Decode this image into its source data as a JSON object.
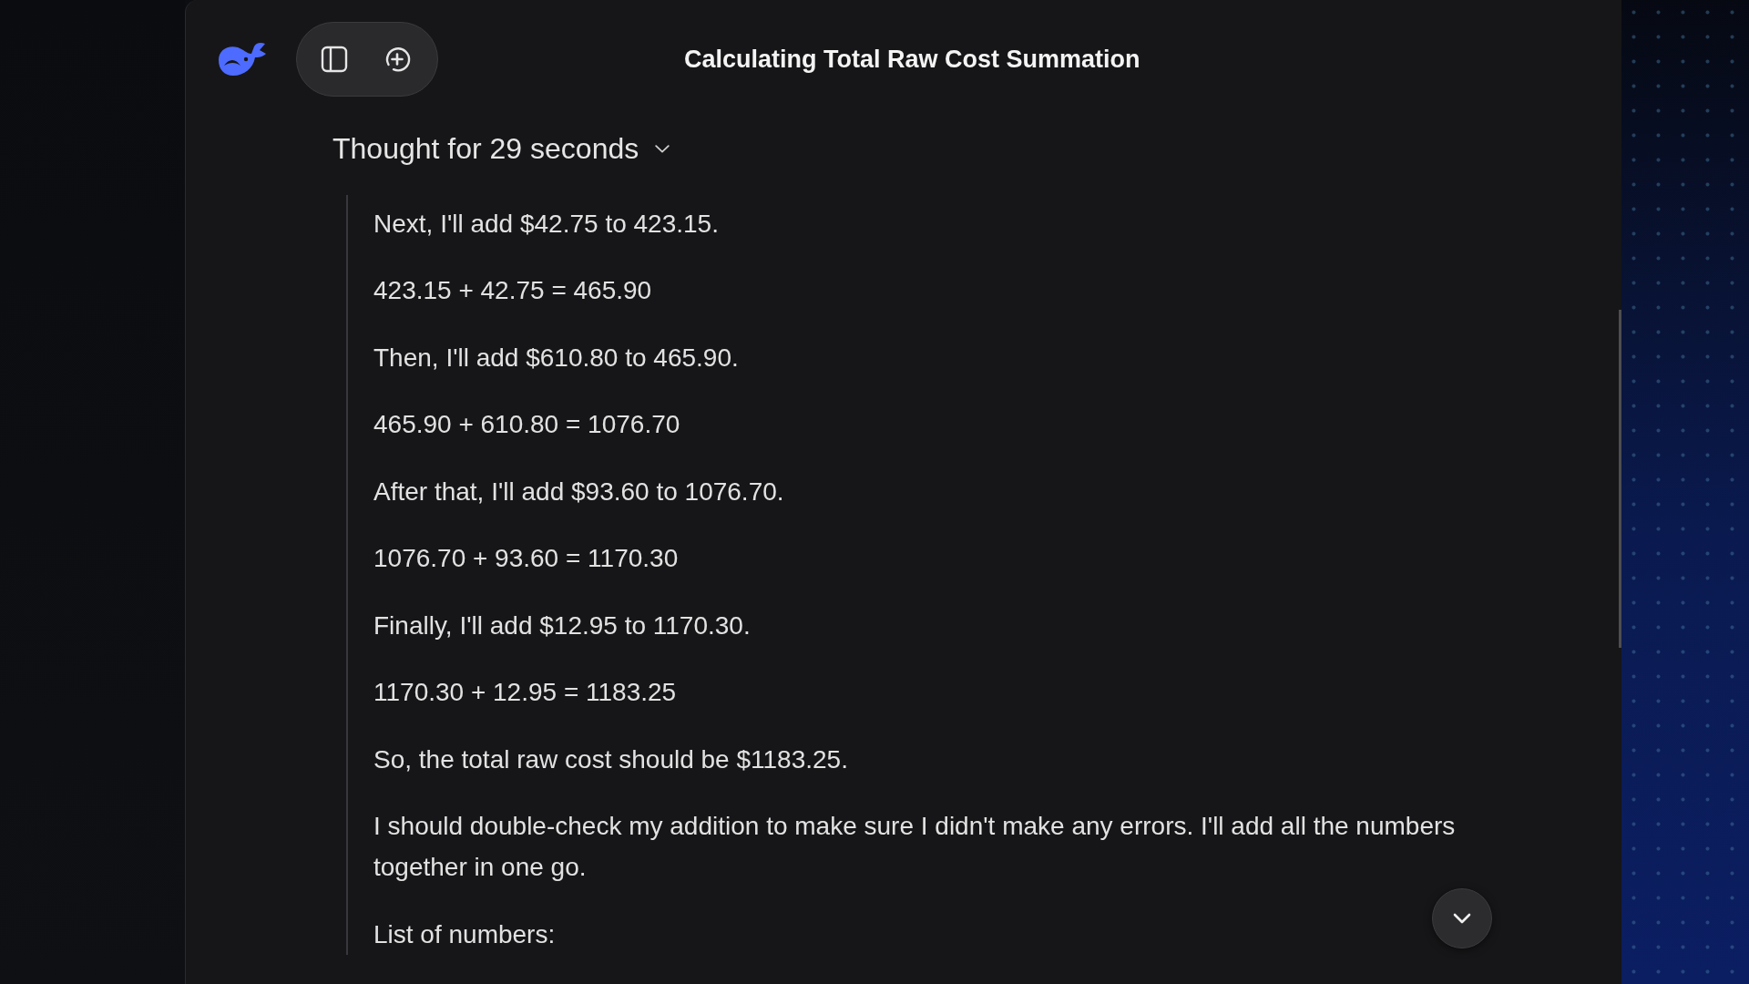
{
  "header": {
    "title": "Calculating Total Raw Cost Summation"
  },
  "thinking": {
    "label": "Thought for 29 seconds",
    "expanded": true,
    "paragraphs": [
      "Next, I'll add $42.75 to 423.15.",
      "423.15 + 42.75 = 465.90",
      "Then, I'll add $610.80 to 465.90.",
      "465.90 + 610.80 = 1076.70",
      "After that, I'll add $93.60 to 1076.70.",
      "1076.70 + 93.60 = 1170.30",
      "Finally, I'll add $12.95 to 1170.30.",
      "1170.30 + 12.95 = 1183.25",
      "So, the total raw cost should be $1183.25.",
      "I should double-check my addition to make sure I didn't make any errors. I'll add all the numbers together in one go.",
      "List of numbers:"
    ]
  }
}
